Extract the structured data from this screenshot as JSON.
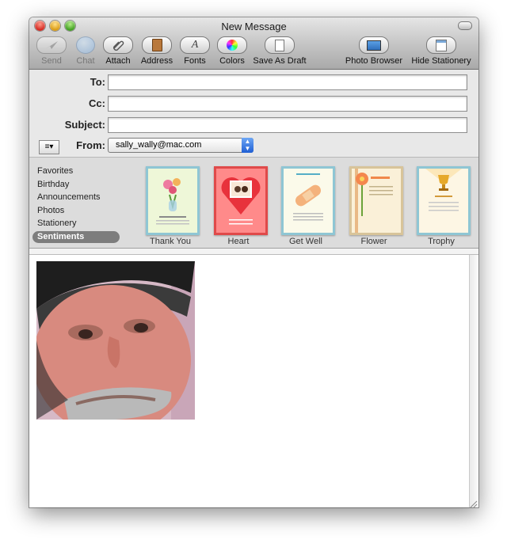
{
  "window": {
    "title": "New Message"
  },
  "toolbar": {
    "items": [
      {
        "label": "Send",
        "icon": "send-icon",
        "enabled": false
      },
      {
        "label": "Chat",
        "icon": "chat-icon",
        "enabled": false
      },
      {
        "label": "Attach",
        "icon": "paperclip-icon",
        "enabled": true
      },
      {
        "label": "Address",
        "icon": "address-book-icon",
        "enabled": true
      },
      {
        "label": "Fonts",
        "icon": "fonts-icon",
        "enabled": true
      },
      {
        "label": "Colors",
        "icon": "color-wheel-icon",
        "enabled": true
      },
      {
        "label": "Save As Draft",
        "icon": "draft-icon",
        "enabled": true
      },
      {
        "label": "Photo Browser",
        "icon": "photo-browser-icon",
        "enabled": true
      },
      {
        "label": "Hide Stationery",
        "icon": "stationery-icon",
        "enabled": true
      }
    ]
  },
  "headers": {
    "to_label": "To:",
    "to_value": "",
    "cc_label": "Cc:",
    "cc_value": "",
    "subject_label": "Subject:",
    "subject_value": "",
    "from_label": "From:",
    "from_value": "sally_wally@mac.com"
  },
  "stationery": {
    "categories": [
      "Favorites",
      "Birthday",
      "Announcements",
      "Photos",
      "Stationery",
      "Sentiments"
    ],
    "selected_category": "Sentiments",
    "templates": [
      "Thank You",
      "Heart",
      "Get Well",
      "Flower",
      "Trophy"
    ]
  },
  "colors": {
    "card_border": "#8fc6d4",
    "selected_category_bg": "#7d7d7d",
    "from_arrows": "#2b6fe0"
  }
}
